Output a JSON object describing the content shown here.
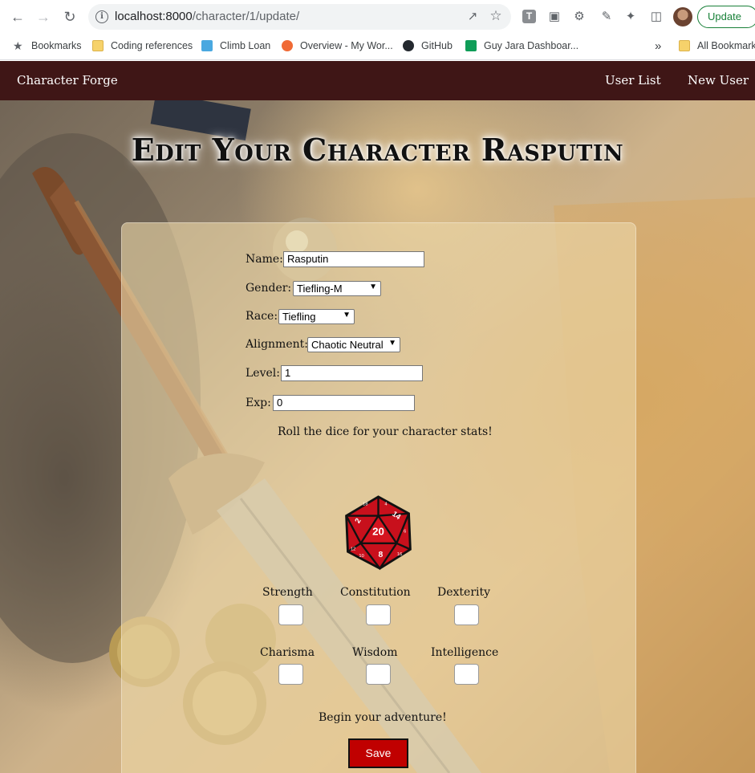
{
  "browser": {
    "url_host": "localhost:8000",
    "url_path": "/character/1/update/",
    "update_label": "Update",
    "bookmarks": [
      {
        "label": "Bookmarks",
        "icon": "star-icon"
      },
      {
        "label": "Coding references",
        "icon": "folder-icon"
      },
      {
        "label": "Climb Loan",
        "icon": "site-icon"
      },
      {
        "label": "Overview - My Wor...",
        "icon": "site-icon"
      },
      {
        "label": "GitHub",
        "icon": "github-icon"
      },
      {
        "label": "Guy Jara Dashboar...",
        "icon": "sheets-icon"
      },
      {
        "label": "All Bookmarks",
        "icon": "folder-icon"
      }
    ],
    "overflow_label": "»"
  },
  "navbar": {
    "brand": "Character Forge",
    "links": [
      "User List",
      "New User"
    ]
  },
  "page": {
    "title": "Edit Your Character Rasputin"
  },
  "form": {
    "name_label": "Name:",
    "name_value": "Rasputin",
    "gender_label": "Gender:",
    "gender_value": "Tiefling-M",
    "race_label": "Race:",
    "race_value": "Tiefling",
    "alignment_label": "Alignment:",
    "alignment_value": "Chaotic Neutral",
    "level_label": "Level:",
    "level_value": "1",
    "exp_label": "Exp:",
    "exp_value": "0",
    "roll_prompt": "Roll the dice for your character stats!",
    "dice_faces": [
      "20",
      "14",
      "2",
      "8",
      "18",
      "10",
      "12",
      "4",
      "6",
      "16"
    ],
    "stats": [
      {
        "label": "Strength",
        "value": ""
      },
      {
        "label": "Constitution",
        "value": ""
      },
      {
        "label": "Dexterity",
        "value": ""
      },
      {
        "label": "Charisma",
        "value": ""
      },
      {
        "label": "Wisdom",
        "value": ""
      },
      {
        "label": "Intelligence",
        "value": ""
      }
    ],
    "adventure_prompt": "Begin your adventure!",
    "save_label": "Save"
  },
  "colors": {
    "navbar": "#3f1616",
    "save_button": "#c00000",
    "die": "#c8101c"
  }
}
